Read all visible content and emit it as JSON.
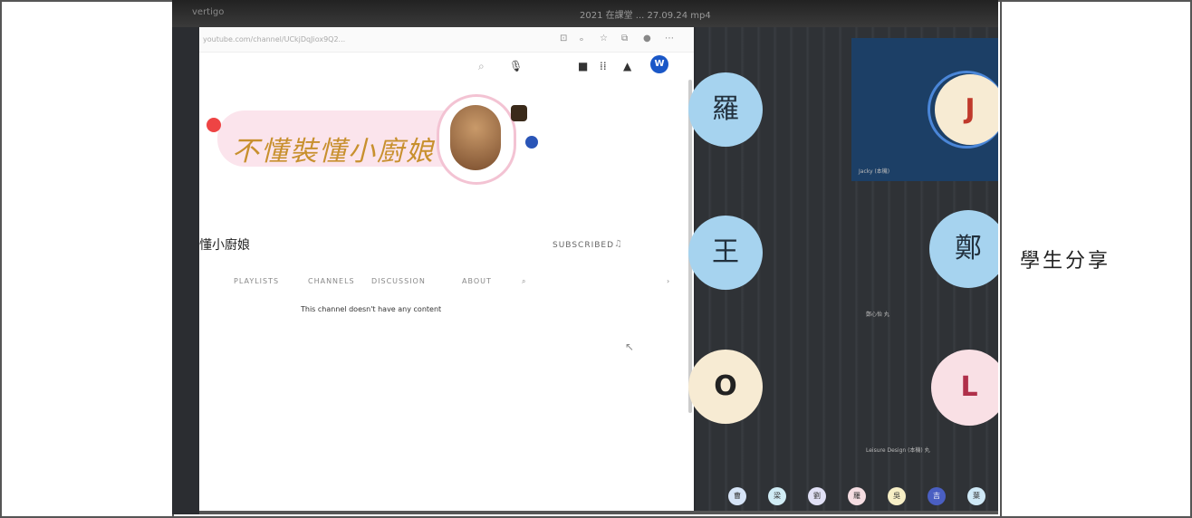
{
  "window": {
    "title_left": "vertigo",
    "title_center": "2021 在課堂 ... 27.09.24 mp4"
  },
  "browser": {
    "url": "youtube.com/channel/UCkjDqJiox9Q2...",
    "avatar_letter": "W",
    "channel_logo_text": "不懂裝懂小廚娘",
    "channel_name": "懂小廚娘",
    "subscribed_label": "SUBSCRIBED",
    "tabs": [
      "PLAYLISTS",
      "CHANNELS",
      "DISCUSSION",
      "ABOUT"
    ],
    "empty_message": "This channel doesn't have any content"
  },
  "meet": {
    "participants": [
      {
        "letter": "羅"
      },
      {
        "letter": "J",
        "name": "Jacky (本機)"
      },
      {
        "letter": "王"
      },
      {
        "letter": "鄭",
        "name": "鄭心怡 丸"
      },
      {
        "letter": "O"
      },
      {
        "letter": "L",
        "name": "Leisure Design (本機) 丸"
      }
    ],
    "strip": [
      "曹",
      "梁",
      "劉",
      "羅",
      "吳",
      "吉",
      "葉"
    ]
  },
  "doc": {
    "right_label": "學生分享"
  },
  "colors": {
    "meet_bg": "#2f3236",
    "avatar_blue": "#1a57c7",
    "circle_blue": "#a6d3ef"
  }
}
